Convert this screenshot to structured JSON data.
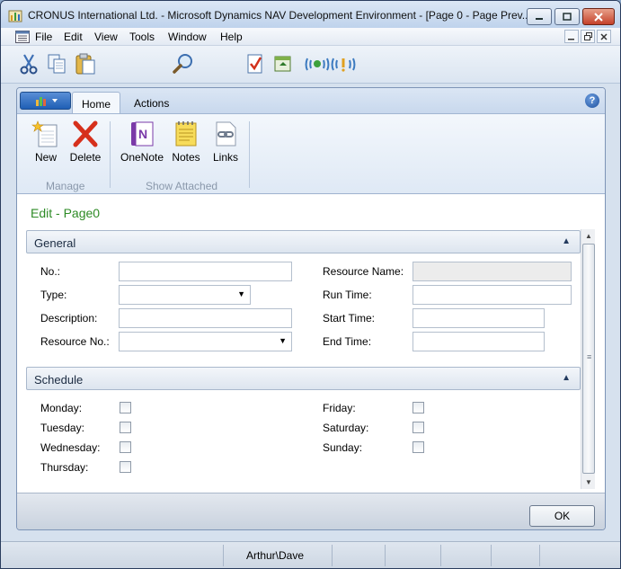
{
  "window": {
    "title": "CRONUS International Ltd. - Microsoft Dynamics NAV Development Environment - [Page 0 - Page Prev..."
  },
  "menu": {
    "items": [
      "File",
      "Edit",
      "View",
      "Tools",
      "Window",
      "Help"
    ]
  },
  "toolbar": {
    "tools": [
      "cut-icon",
      "copy-icon",
      "paste-icon",
      "find-icon",
      "design-icon",
      "run-icon",
      "connect-icon",
      "disconnect-icon"
    ]
  },
  "ribbon": {
    "tabs": [
      "Home",
      "Actions"
    ],
    "active_tab": "Home",
    "groups": [
      {
        "label": "Manage",
        "buttons": [
          {
            "label": "New",
            "icon": "new-icon"
          },
          {
            "label": "Delete",
            "icon": "delete-icon"
          }
        ]
      },
      {
        "label": "Show Attached",
        "buttons": [
          {
            "label": "OneNote",
            "icon": "onenote-icon"
          },
          {
            "label": "Notes",
            "icon": "notes-icon"
          },
          {
            "label": "Links",
            "icon": "links-icon"
          }
        ]
      }
    ]
  },
  "page": {
    "title": "Edit - Page0",
    "general": {
      "header": "General",
      "fields": {
        "no": {
          "label": "No.:",
          "value": ""
        },
        "type": {
          "label": "Type:",
          "value": ""
        },
        "description": {
          "label": "Description:",
          "value": ""
        },
        "resource_no": {
          "label": "Resource No.:",
          "value": ""
        },
        "resource_name": {
          "label": "Resource Name:",
          "value": ""
        },
        "run_time": {
          "label": "Run Time:",
          "value": ""
        },
        "start_time": {
          "label": "Start Time:",
          "value": ""
        },
        "end_time": {
          "label": "End Time:",
          "value": ""
        }
      }
    },
    "schedule": {
      "header": "Schedule",
      "days": {
        "monday": {
          "label": "Monday:",
          "checked": false
        },
        "tuesday": {
          "label": "Tuesday:",
          "checked": false
        },
        "wednesday": {
          "label": "Wednesday:",
          "checked": false
        },
        "thursday": {
          "label": "Thursday:",
          "checked": false
        },
        "friday": {
          "label": "Friday:",
          "checked": false
        },
        "saturday": {
          "label": "Saturday:",
          "checked": false
        },
        "sunday": {
          "label": "Sunday:",
          "checked": false
        }
      }
    },
    "ok_label": "OK"
  },
  "status": {
    "user": "Arthur\\Dave"
  },
  "colors": {
    "accent_green": "#2e8b26",
    "title_bar": "#bfd3ec",
    "close_red": "#c4412a"
  }
}
